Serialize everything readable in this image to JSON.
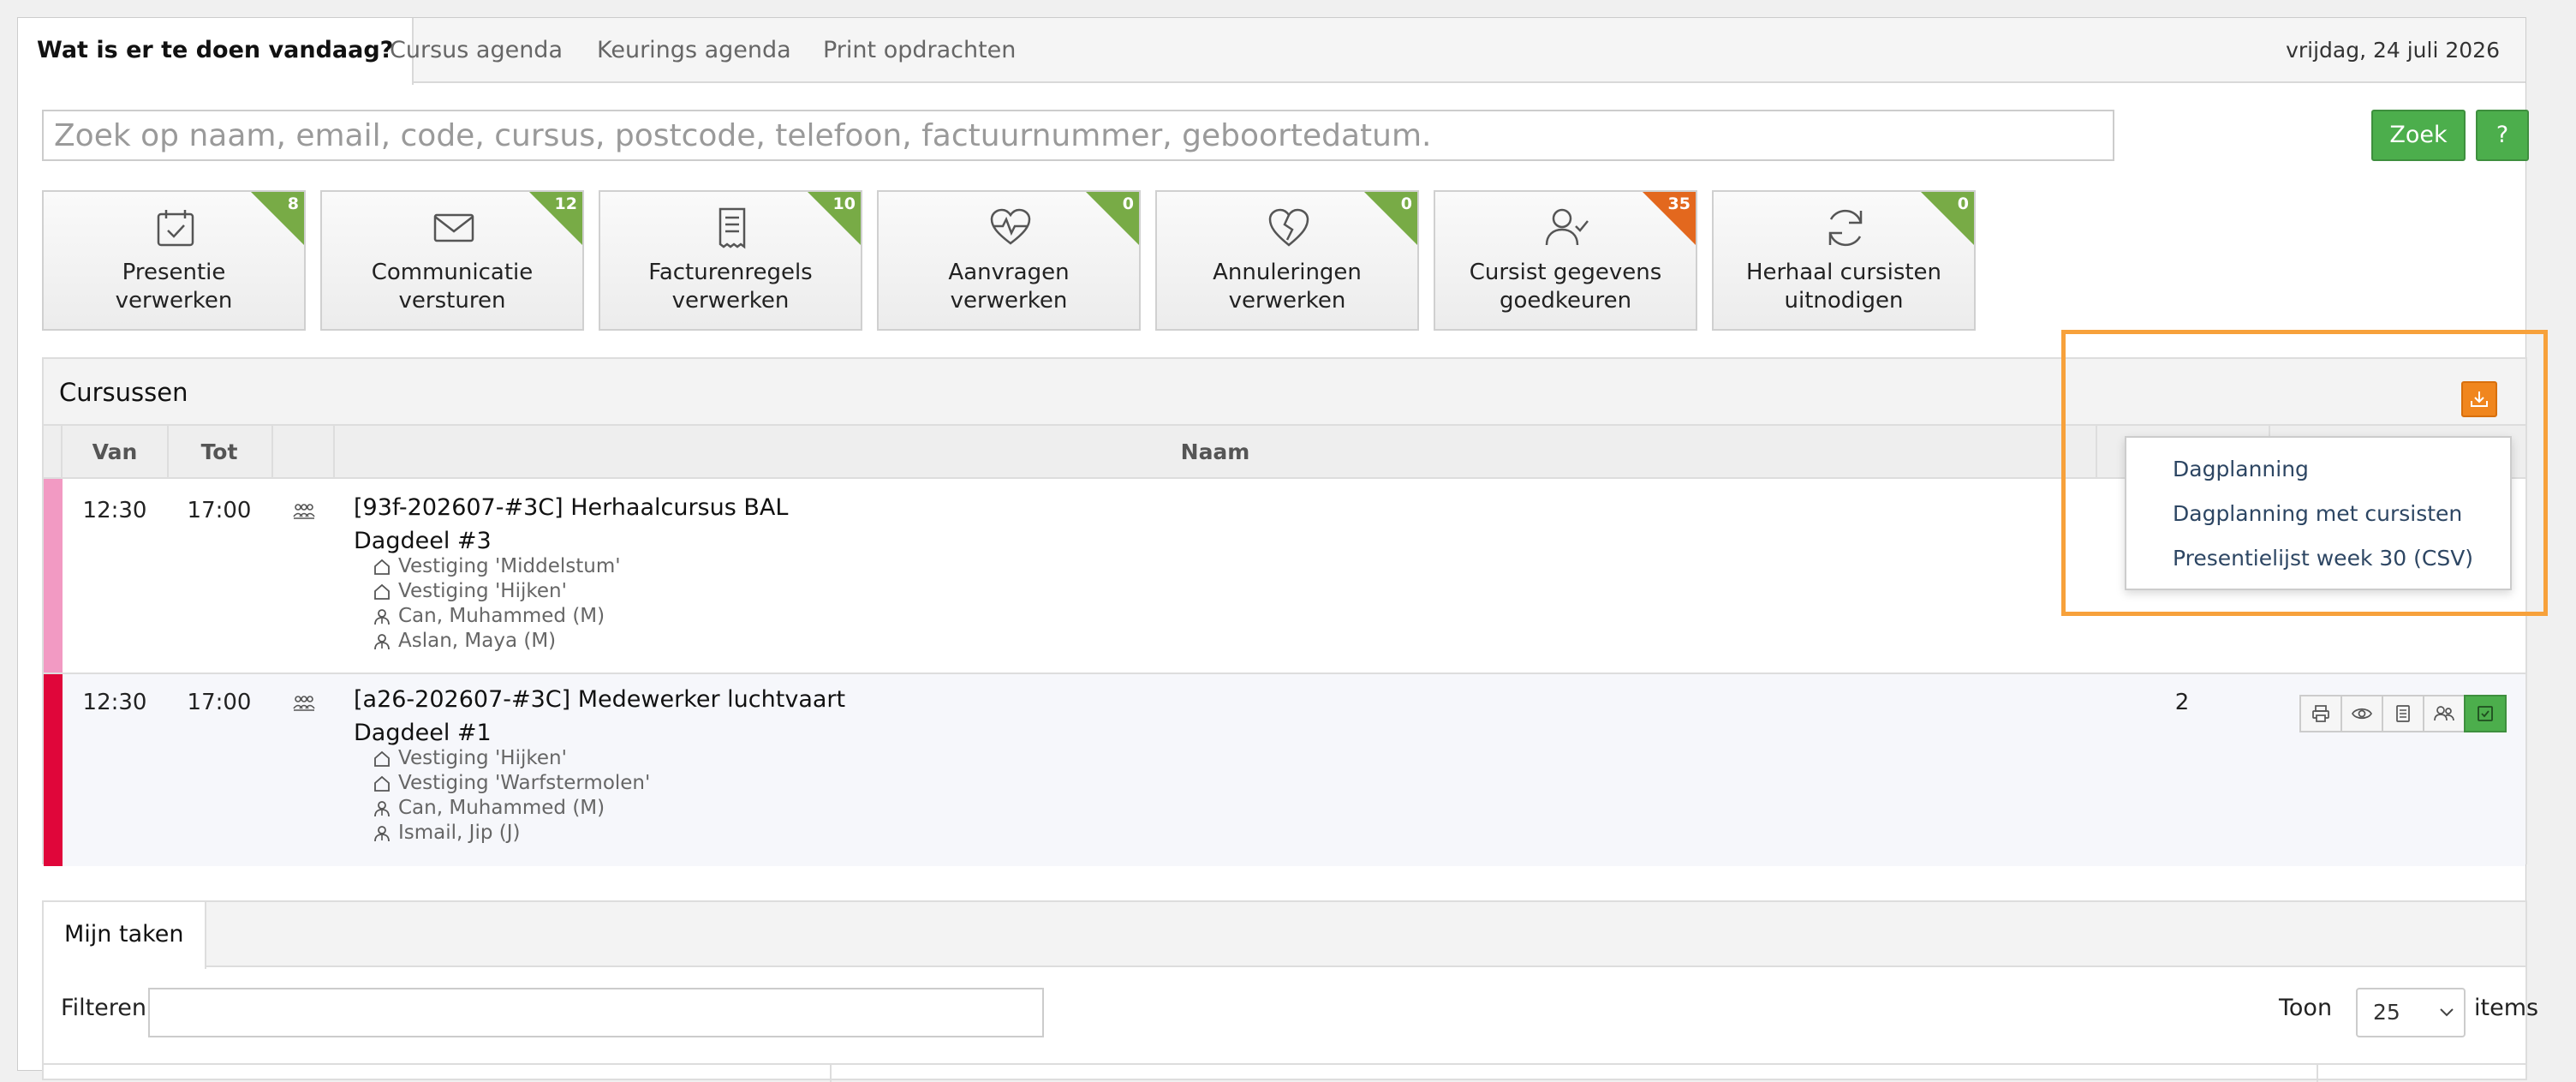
{
  "tabs": [
    {
      "label": "Wat is er te doen vandaag?",
      "active": true
    },
    {
      "label": "Cursus agenda"
    },
    {
      "label": "Keurings agenda"
    },
    {
      "label": "Print opdrachten"
    }
  ],
  "date": "vrijdag, 24 juli 2026",
  "search": {
    "placeholder": "Zoek op naam, email, code, cursus, postcode, telefoon, factuurnummer, geboortedatum.",
    "button": "Zoek",
    "help": "?"
  },
  "tiles": [
    {
      "line1": "Presentie",
      "line2": "verwerken",
      "count": "8",
      "icon": "calendar-check-icon"
    },
    {
      "line1": "Communicatie",
      "line2": "versturen",
      "count": "12",
      "icon": "envelope-icon"
    },
    {
      "line1": "Facturenregels",
      "line2": "verwerken",
      "count": "10",
      "icon": "receipt-icon"
    },
    {
      "line1": "Aanvragen",
      "line2": "verwerken",
      "count": "0",
      "icon": "heart-pulse-icon"
    },
    {
      "line1": "Annuleringen",
      "line2": "verwerken",
      "count": "0",
      "icon": "heart-broken-icon"
    },
    {
      "line1": "Cursist gegevens",
      "line2": "goedkeuren",
      "count": "35",
      "icon": "user-check-icon",
      "accent": "#e3681e"
    },
    {
      "line1": "Herhaal cursisten",
      "line2": "uitnodigen",
      "count": "0",
      "icon": "refresh-icon"
    }
  ],
  "courses": {
    "title": "Cursussen",
    "headers": {
      "from": "Van",
      "to": "Tot",
      "name": "Naam"
    },
    "rows": [
      {
        "color": "#f29ac3",
        "from": "12:30",
        "to": "17:00",
        "title": "[93f-202607-#3C] Herhaalcursus BAL",
        "dagdeel": "Dagdeel #3",
        "locations": [
          "Vestiging 'Middelstum'",
          "Vestiging 'Hijken'"
        ],
        "instructors": [
          "Can, Muhammed (M)",
          "Aslan, Maya (M)"
        ]
      },
      {
        "color": "#e0063a",
        "from": "12:30",
        "to": "17:00",
        "title": "[a26-202607-#3C] Medewerker luchtvaart",
        "dagdeel": "Dagdeel #1",
        "locations": [
          "Vestiging 'Hijken'",
          "Vestiging 'Warfstermolen'"
        ],
        "instructors": [
          "Can, Muhammed (M)",
          "Ismail, Jip (J)"
        ],
        "count": "2"
      }
    ]
  },
  "download_menu": {
    "items": [
      "Dagplanning",
      "Dagplanning met cursisten",
      "Presentielijst week 30 (CSV)"
    ]
  },
  "tasks": {
    "tab": "Mijn taken",
    "filter_label": "Filteren",
    "show_label": "Toon",
    "show_value": "25",
    "items_label": "items"
  },
  "colors": {
    "green": "#4cae4c",
    "orange": "#f0861e",
    "highlight": "#f7a13b"
  }
}
